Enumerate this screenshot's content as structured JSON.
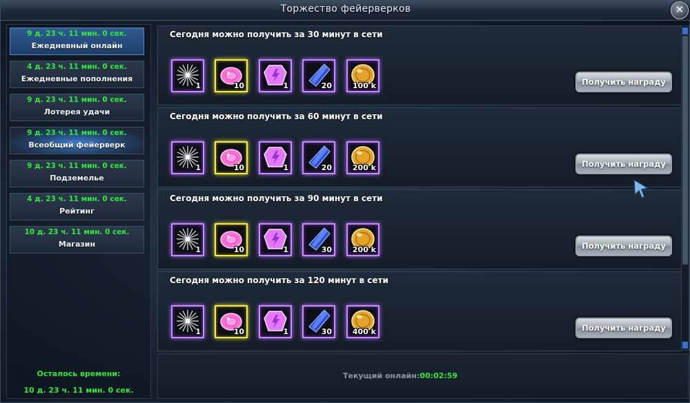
{
  "window": {
    "title": "Торжество фейерверков"
  },
  "sidebar": {
    "items": [
      {
        "timer": "9 д. 23 ч. 11 мин. 0 сек.",
        "label": "Ежедневный онлайн"
      },
      {
        "timer": "4 д. 23 ч. 11 мин. 0 сек.",
        "label": "Ежедневные пополнения"
      },
      {
        "timer": "9 д. 23 ч. 11 мин. 0 сек.",
        "label": "Лотерея удачи"
      },
      {
        "timer": "9 д. 23 ч. 11 мин. 0 сек.",
        "label": "Всеобщий фейерверк"
      },
      {
        "timer": "9 д. 23 ч. 11 мин. 0 сек.",
        "label": "Подземелье"
      },
      {
        "timer": "4 д. 23 ч. 11 мин. 0 сек.",
        "label": "Рейтинг"
      },
      {
        "timer": "10 д. 23 ч. 11 мин. 0 сек.",
        "label": "Магазин"
      }
    ],
    "active_index": 0,
    "remaining_label": "Осталось времени:",
    "remaining_value": "10 д. 23 ч. 11 мин. 0 сек."
  },
  "rewards": [
    {
      "title": "Сегодня можно получить за 30 минут в сети",
      "items": [
        {
          "icon": "firework-icon",
          "frame": "purple",
          "qty": "1"
        },
        {
          "icon": "pink-gem-icon",
          "frame": "yellow",
          "qty": "10"
        },
        {
          "icon": "purple-crystal-icon",
          "frame": "purple",
          "qty": "1"
        },
        {
          "icon": "blue-crystal-icon",
          "frame": "purple",
          "qty": "20"
        },
        {
          "icon": "gold-coin-icon",
          "frame": "purple",
          "qty": "100 k"
        }
      ],
      "button": "Получить награду"
    },
    {
      "title": "Сегодня можно получить за 60 минут в сети",
      "items": [
        {
          "icon": "firework-icon",
          "frame": "purple",
          "qty": "1"
        },
        {
          "icon": "pink-gem-icon",
          "frame": "yellow",
          "qty": "10"
        },
        {
          "icon": "purple-crystal-icon",
          "frame": "purple",
          "qty": "1"
        },
        {
          "icon": "blue-crystal-icon",
          "frame": "purple",
          "qty": "20"
        },
        {
          "icon": "gold-coin-icon",
          "frame": "purple",
          "qty": "200 k"
        }
      ],
      "button": "Получить награду"
    },
    {
      "title": "Сегодня можно получить за 90 минут в сети",
      "items": [
        {
          "icon": "firework-icon",
          "frame": "purple",
          "qty": "1"
        },
        {
          "icon": "pink-gem-icon",
          "frame": "yellow",
          "qty": "10"
        },
        {
          "icon": "purple-crystal-icon",
          "frame": "purple",
          "qty": "1"
        },
        {
          "icon": "blue-crystal-icon",
          "frame": "purple",
          "qty": "30"
        },
        {
          "icon": "gold-coin-icon",
          "frame": "purple",
          "qty": "200 k"
        }
      ],
      "button": "Получить награду"
    },
    {
      "title": "Сегодня можно получить за 120 минут в сети",
      "items": [
        {
          "icon": "firework-icon",
          "frame": "purple",
          "qty": "1"
        },
        {
          "icon": "pink-gem-icon",
          "frame": "yellow",
          "qty": "10"
        },
        {
          "icon": "purple-crystal-icon",
          "frame": "purple",
          "qty": "1"
        },
        {
          "icon": "blue-crystal-icon",
          "frame": "purple",
          "qty": "30"
        },
        {
          "icon": "gold-coin-icon",
          "frame": "purple",
          "qty": "400 k"
        }
      ],
      "button": "Получить награду"
    }
  ],
  "footer": {
    "online_label": "Текущий онлайн:",
    "online_value": "00:02:59"
  },
  "colors": {
    "timer_green": "#2eea3b",
    "active_tab": "#2f5b91",
    "purple_frame": "#c58bff",
    "yellow_frame": "#f3ef3a"
  }
}
